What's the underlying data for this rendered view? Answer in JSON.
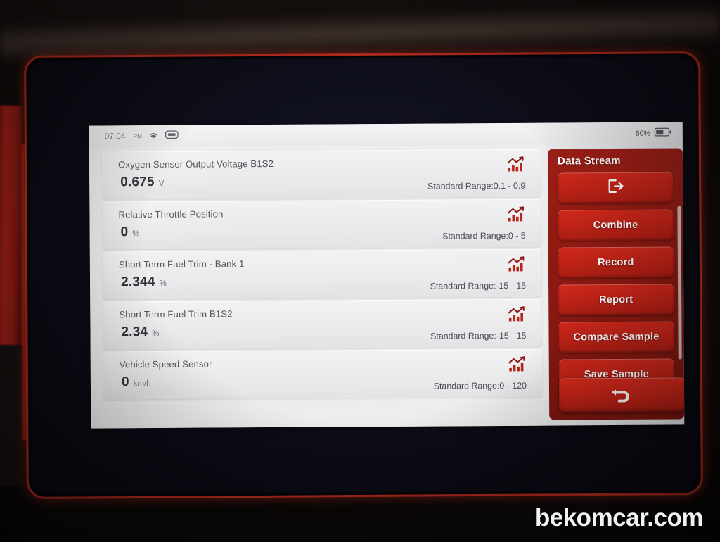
{
  "status_bar": {
    "time": "07:04",
    "meridiem": "PM",
    "wifi_icon": "wifi-icon",
    "vci_icon": "vci-connector-icon",
    "battery_percent": "60%",
    "battery_icon": "battery-icon"
  },
  "data_stream": {
    "rows": [
      {
        "name": "Oxygen Sensor Output Voltage B1S2",
        "value": "0.675",
        "unit": "V",
        "range": "Standard Range:0.1 - 0.9",
        "chart_icon": "bar-chart-icon"
      },
      {
        "name": "Relative Throttle Position",
        "value": "0",
        "unit": "%",
        "range": "Standard Range:0 - 5",
        "chart_icon": "bar-chart-icon"
      },
      {
        "name": "Short Term Fuel Trim - Bank 1",
        "value": "2.344",
        "unit": "%",
        "range": "Standard Range:-15 - 15",
        "chart_icon": "bar-chart-icon"
      },
      {
        "name": "Short Term Fuel Trim B1S2",
        "value": "2.34",
        "unit": "%",
        "range": "Standard Range:-15 - 15",
        "chart_icon": "bar-chart-icon"
      },
      {
        "name": "Vehicle Speed Sensor",
        "value": "0",
        "unit": "km/h",
        "range": "Standard Range:0 - 120",
        "chart_icon": "bar-chart-icon"
      }
    ]
  },
  "side_panel": {
    "title": "Data Stream",
    "buttons": [
      {
        "label": "",
        "icon": "exit-icon"
      },
      {
        "label": "Combine",
        "icon": ""
      },
      {
        "label": "Record",
        "icon": ""
      },
      {
        "label": "Report",
        "icon": ""
      },
      {
        "label": "Compare Sample",
        "icon": ""
      },
      {
        "label": "Save Sample",
        "icon": ""
      }
    ],
    "back_button_icon": "back-arrow-icon"
  },
  "watermark": "bekomcar.com",
  "colors": {
    "panel_red": "#8d1a12",
    "button_red": "#c02317",
    "screen_bg": "#eceded",
    "bezel_red": "#b02a1e"
  }
}
